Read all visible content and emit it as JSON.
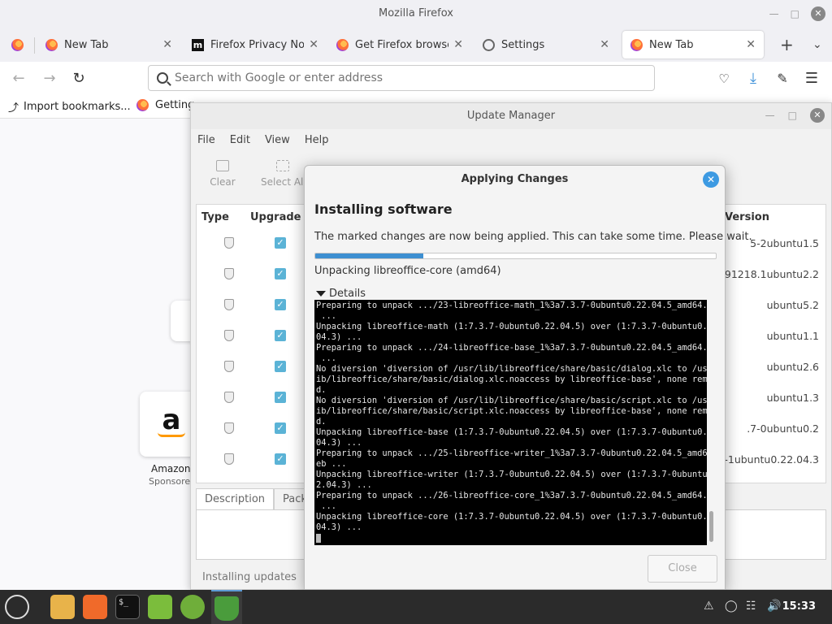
{
  "firefox": {
    "window_title": "Mozilla Firefox",
    "tabs": [
      {
        "label": ""
      },
      {
        "label": "New Tab"
      },
      {
        "label": "Firefox Privacy Notice"
      },
      {
        "label": "Get Firefox browser"
      },
      {
        "label": "Settings"
      },
      {
        "label": "New Tab"
      }
    ],
    "new_tab_symbol": "+",
    "url_placeholder": "Search with Google or enter address",
    "bookmarks": [
      {
        "label": "Import bookmarks..."
      },
      {
        "label": "Getting"
      }
    ],
    "tiles": [
      {
        "letter": "a",
        "label": "Amazon",
        "sub": "Sponsored"
      }
    ]
  },
  "update_manager": {
    "title": "Update Manager",
    "menu": [
      "File",
      "Edit",
      "View",
      "Help"
    ],
    "toolbar": {
      "clear": "Clear",
      "select_all": "Select All"
    },
    "columns": {
      "type": "Type",
      "upgrade": "Upgrade",
      "version": "Version"
    },
    "rows": [
      {
        "version": "5-2ubuntu1.5"
      },
      {
        "version": "91218.1ubuntu2.2"
      },
      {
        "version": "ubuntu5.2"
      },
      {
        "version": "ubuntu1.1"
      },
      {
        "version": "ubuntu2.6"
      },
      {
        "version": "ubuntu1.3"
      },
      {
        "version": ".7-0ubuntu0.2"
      },
      {
        "version": "-1ubuntu0.22.04.3"
      }
    ],
    "tabs": {
      "description": "Description",
      "packages": "Packages"
    },
    "status": "Installing updates"
  },
  "dialog": {
    "title": "Applying Changes",
    "heading": "Installing software",
    "message": "The marked changes are now being applied. This can take some time. Please wait.",
    "progress": 0.27,
    "status": "Unpacking libreoffice-core (amd64)",
    "details_label": "Details",
    "terminal": "Preparing to unpack .../23-libreoffice-math_1%3a7.3.7-0ubuntu0.22.04.5_amd64.deb\n ...\nUnpacking libreoffice-math (1:7.3.7-0ubuntu0.22.04.5) over (1:7.3.7-0ubuntu0.22.\n04.3) ...\nPreparing to unpack .../24-libreoffice-base_1%3a7.3.7-0ubuntu0.22.04.5_amd64.deb\n ...\nNo diversion 'diversion of /usr/lib/libreoffice/share/basic/dialog.xlc to /usr/l\nib/libreoffice/share/basic/dialog.xlc.noaccess by libreoffice-base', none remove\nd.\nNo diversion 'diversion of /usr/lib/libreoffice/share/basic/script.xlc to /usr/l\nib/libreoffice/share/basic/script.xlc.noaccess by libreoffice-base', none remove\nd.\nUnpacking libreoffice-base (1:7.3.7-0ubuntu0.22.04.5) over (1:7.3.7-0ubuntu0.22.\n04.3) ...\nPreparing to unpack .../25-libreoffice-writer_1%3a7.3.7-0ubuntu0.22.04.5_amd64.d\neb ...\nUnpacking libreoffice-writer (1:7.3.7-0ubuntu0.22.04.5) over (1:7.3.7-0ubuntu0.2\n2.04.3) ...\nPreparing to unpack .../26-libreoffice-core_1%3a7.3.7-0ubuntu0.22.04.5_amd64.deb\n ...\nUnpacking libreoffice-core (1:7.3.7-0ubuntu0.22.04.5) over (1:7.3.7-0ubuntu0.22.\n04.3) ...\n",
    "close_label": "Close"
  },
  "taskbar": {
    "clock": "15:33",
    "terminal_prompt": "$_"
  }
}
